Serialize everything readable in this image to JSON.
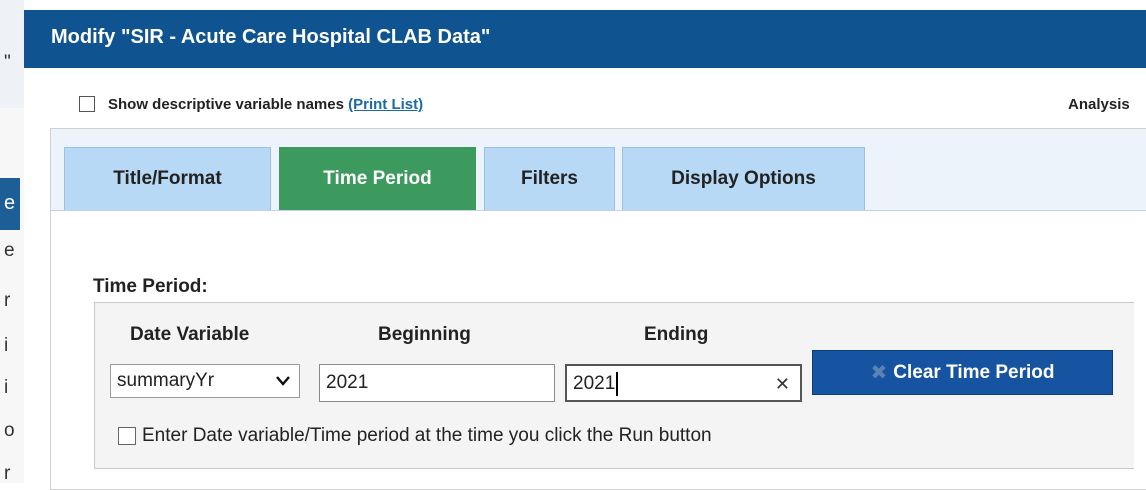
{
  "background_page": {
    "visible_fragments": [
      "\"",
      "e",
      "e",
      "r",
      "i",
      "i",
      "o",
      "r"
    ]
  },
  "dialog": {
    "title": "Modify \"SIR - Acute Care Hospital CLAB Data\"",
    "show_descriptive_label": "Show descriptive variable names",
    "print_list_link": "(Print List)",
    "analysis_label": "Analysis",
    "show_descriptive_checked": false
  },
  "tabs": [
    {
      "label": "Title/Format",
      "active": false
    },
    {
      "label": "Time Period",
      "active": true
    },
    {
      "label": "Filters",
      "active": false
    },
    {
      "label": "Display Options",
      "active": false
    }
  ],
  "time_period": {
    "heading": "Time Period:",
    "col_date_variable": "Date Variable",
    "col_beginning": "Beginning",
    "col_ending": "Ending",
    "date_variable_value": "summaryYr",
    "beginning_value": "2021",
    "ending_value": "2021",
    "clear_button_label": "Clear Time Period",
    "run_checkbox_label": "Enter Date variable/Time period at the time you click the Run button",
    "run_checkbox_checked": false
  },
  "icons": {
    "select_chevron": "chevron-down-icon",
    "input_clear": "clear-x-icon",
    "button_icon": "x-icon"
  },
  "colors": {
    "titlebar": "#0f5491",
    "active_tab": "#3c9a5f",
    "inactive_tab": "#b7d9f6",
    "primary_button": "#1653a0",
    "link": "#1b6aa5"
  }
}
